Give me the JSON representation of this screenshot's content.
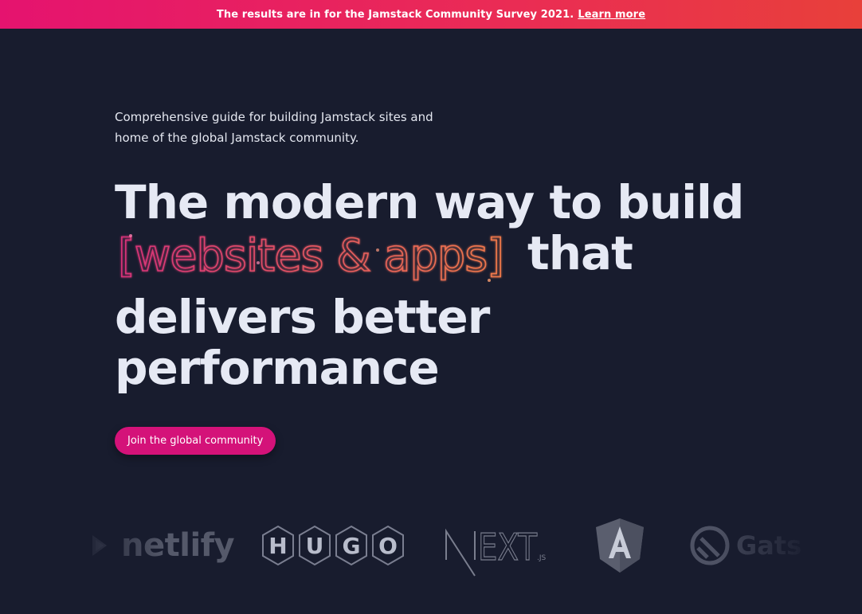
{
  "banner": {
    "text": "The results are in for the Jamstack Community Survey 2021.",
    "link": "Learn more"
  },
  "intro": {
    "line1": "Comprehensive guide for building Jamstack sites and",
    "line2": "home of the global Jamstack community."
  },
  "headline": {
    "line1": "The modern way to build",
    "highlight": "[websites & apps]",
    "that": "that",
    "line3": "delivers better",
    "line4": "performance"
  },
  "cta": {
    "label": "Join the global community"
  },
  "logos": {
    "netlify": "netlify",
    "hugo_letters": [
      "H",
      "U",
      "G",
      "O"
    ],
    "next": "NEXT",
    "next_suffix": ".JS",
    "gatsby": "Gats"
  },
  "colors": {
    "background": "#181c2e",
    "banner_start": "#e5136f",
    "banner_end": "#e8403a",
    "cta": "#d41279",
    "highlight_start": "#e0407a",
    "highlight_end": "#f07a4a"
  }
}
